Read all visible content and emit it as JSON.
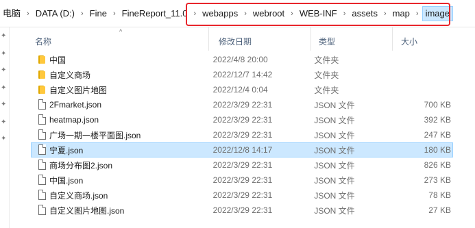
{
  "breadcrumbs": [
    {
      "label": "电脑"
    },
    {
      "label": "DATA (D:)"
    },
    {
      "label": "Fine"
    },
    {
      "label": "FineReport_11.0"
    },
    {
      "label": "webapps"
    },
    {
      "label": "webroot"
    },
    {
      "label": "WEB-INF"
    },
    {
      "label": "assets"
    },
    {
      "label": "map"
    },
    {
      "label": "image"
    }
  ],
  "breadcrumb_separator": "›",
  "columns": {
    "name": "名称",
    "date": "修改日期",
    "type": "类型",
    "size": "大小"
  },
  "sort_indicator": "^",
  "files": [
    {
      "name": "中国",
      "date": "2022/4/8 20:00",
      "type": "文件夹",
      "size": "",
      "icon": "folder-icon"
    },
    {
      "name": "自定义商场",
      "date": "2022/12/7 14:42",
      "type": "文件夹",
      "size": "",
      "icon": "folder-icon"
    },
    {
      "name": "自定义图片地图",
      "date": "2022/12/4 0:04",
      "type": "文件夹",
      "size": "",
      "icon": "folder-icon"
    },
    {
      "name": "2Fmarket.json",
      "date": "2022/3/29 22:31",
      "type": "JSON 文件",
      "size": "700 KB",
      "icon": "file-icon"
    },
    {
      "name": "heatmap.json",
      "date": "2022/3/29 22:31",
      "type": "JSON 文件",
      "size": "392 KB",
      "icon": "file-icon"
    },
    {
      "name": "广场一期一楼平面图.json",
      "date": "2022/3/29 22:31",
      "type": "JSON 文件",
      "size": "247 KB",
      "icon": "file-icon"
    },
    {
      "name": "宁夏.json",
      "date": "2022/12/8 14:17",
      "type": "JSON 文件",
      "size": "180 KB",
      "icon": "file-icon",
      "selected": true
    },
    {
      "name": "商场分布图2.json",
      "date": "2022/3/29 22:31",
      "type": "JSON 文件",
      "size": "826 KB",
      "icon": "file-icon"
    },
    {
      "name": "中国.json",
      "date": "2022/3/29 22:31",
      "type": "JSON 文件",
      "size": "273 KB",
      "icon": "file-icon"
    },
    {
      "name": "自定义商场.json",
      "date": "2022/3/29 22:31",
      "type": "JSON 文件",
      "size": "78 KB",
      "icon": "file-icon"
    },
    {
      "name": "自定义图片地图.json",
      "date": "2022/3/29 22:31",
      "type": "JSON 文件",
      "size": "27 KB",
      "icon": "file-icon"
    }
  ],
  "colors": {
    "selection": "#cce8ff",
    "selection_border": "#99d1ff",
    "highlight_box": "#e8262c",
    "folder": "#ffc83d"
  }
}
